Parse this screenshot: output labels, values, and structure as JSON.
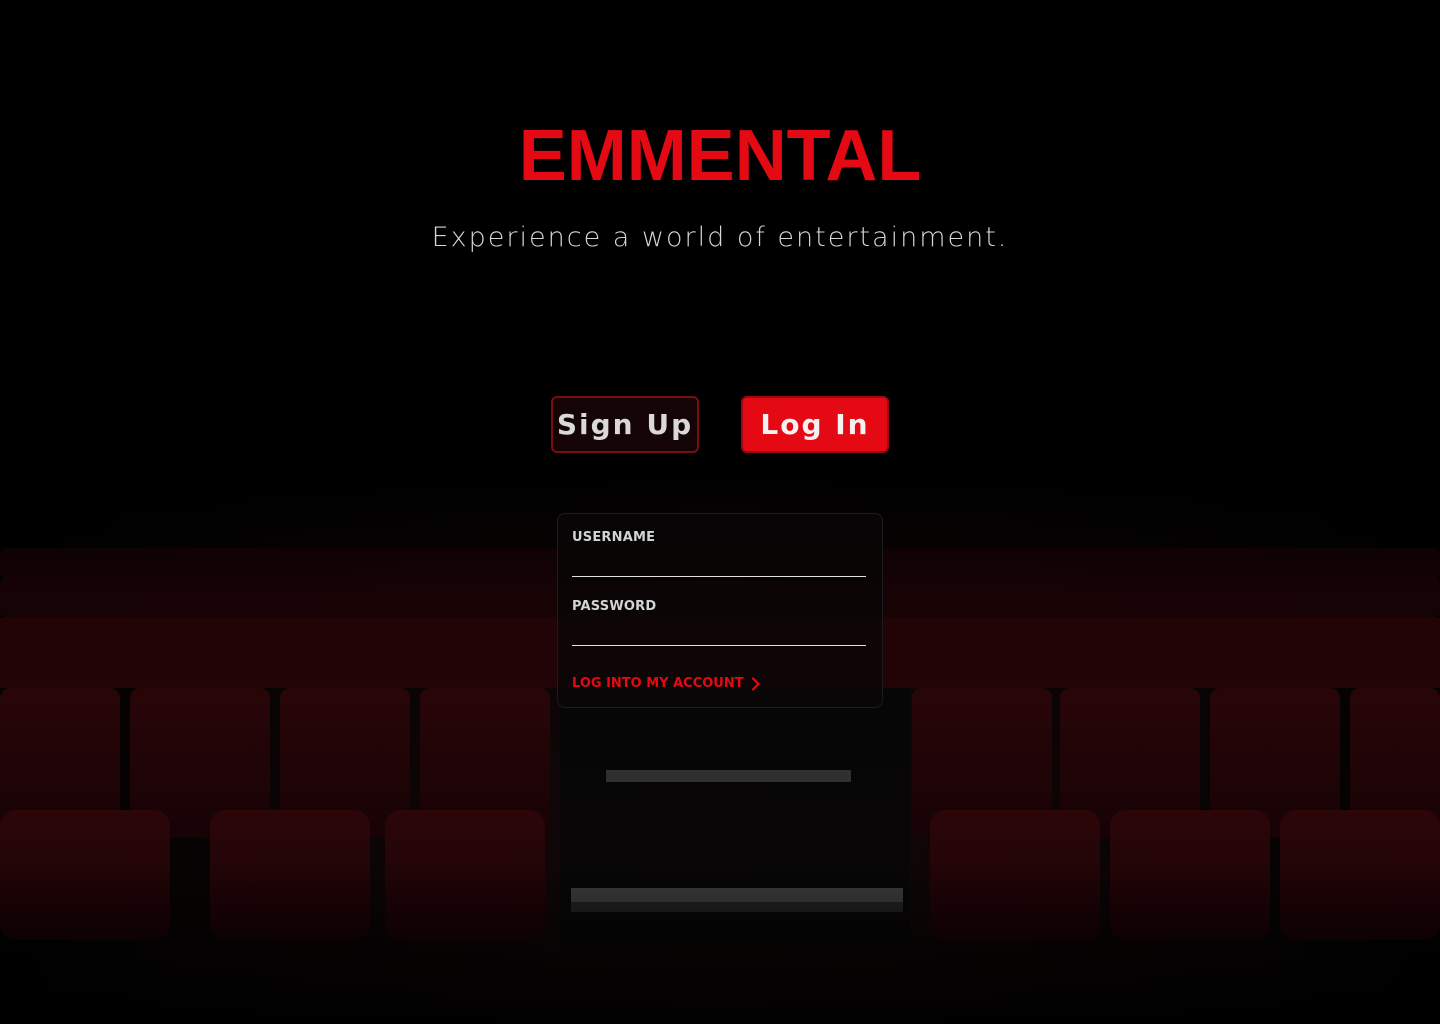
{
  "brand": {
    "name": "EMMENTAL",
    "tagline": "Experience a world of entertainment.",
    "accent_color": "#e50914"
  },
  "tabs": {
    "signup_label": "Sign Up",
    "login_label": "Log In",
    "active": "login"
  },
  "login_form": {
    "username_label": "USERNAME",
    "username_value": "",
    "password_label": "PASSWORD",
    "password_value": "",
    "submit_label": "LOG INTO MY ACCOUNT",
    "submit_icon": "chevron-right-icon"
  },
  "background": {
    "scene": "theater-seats-icon"
  }
}
